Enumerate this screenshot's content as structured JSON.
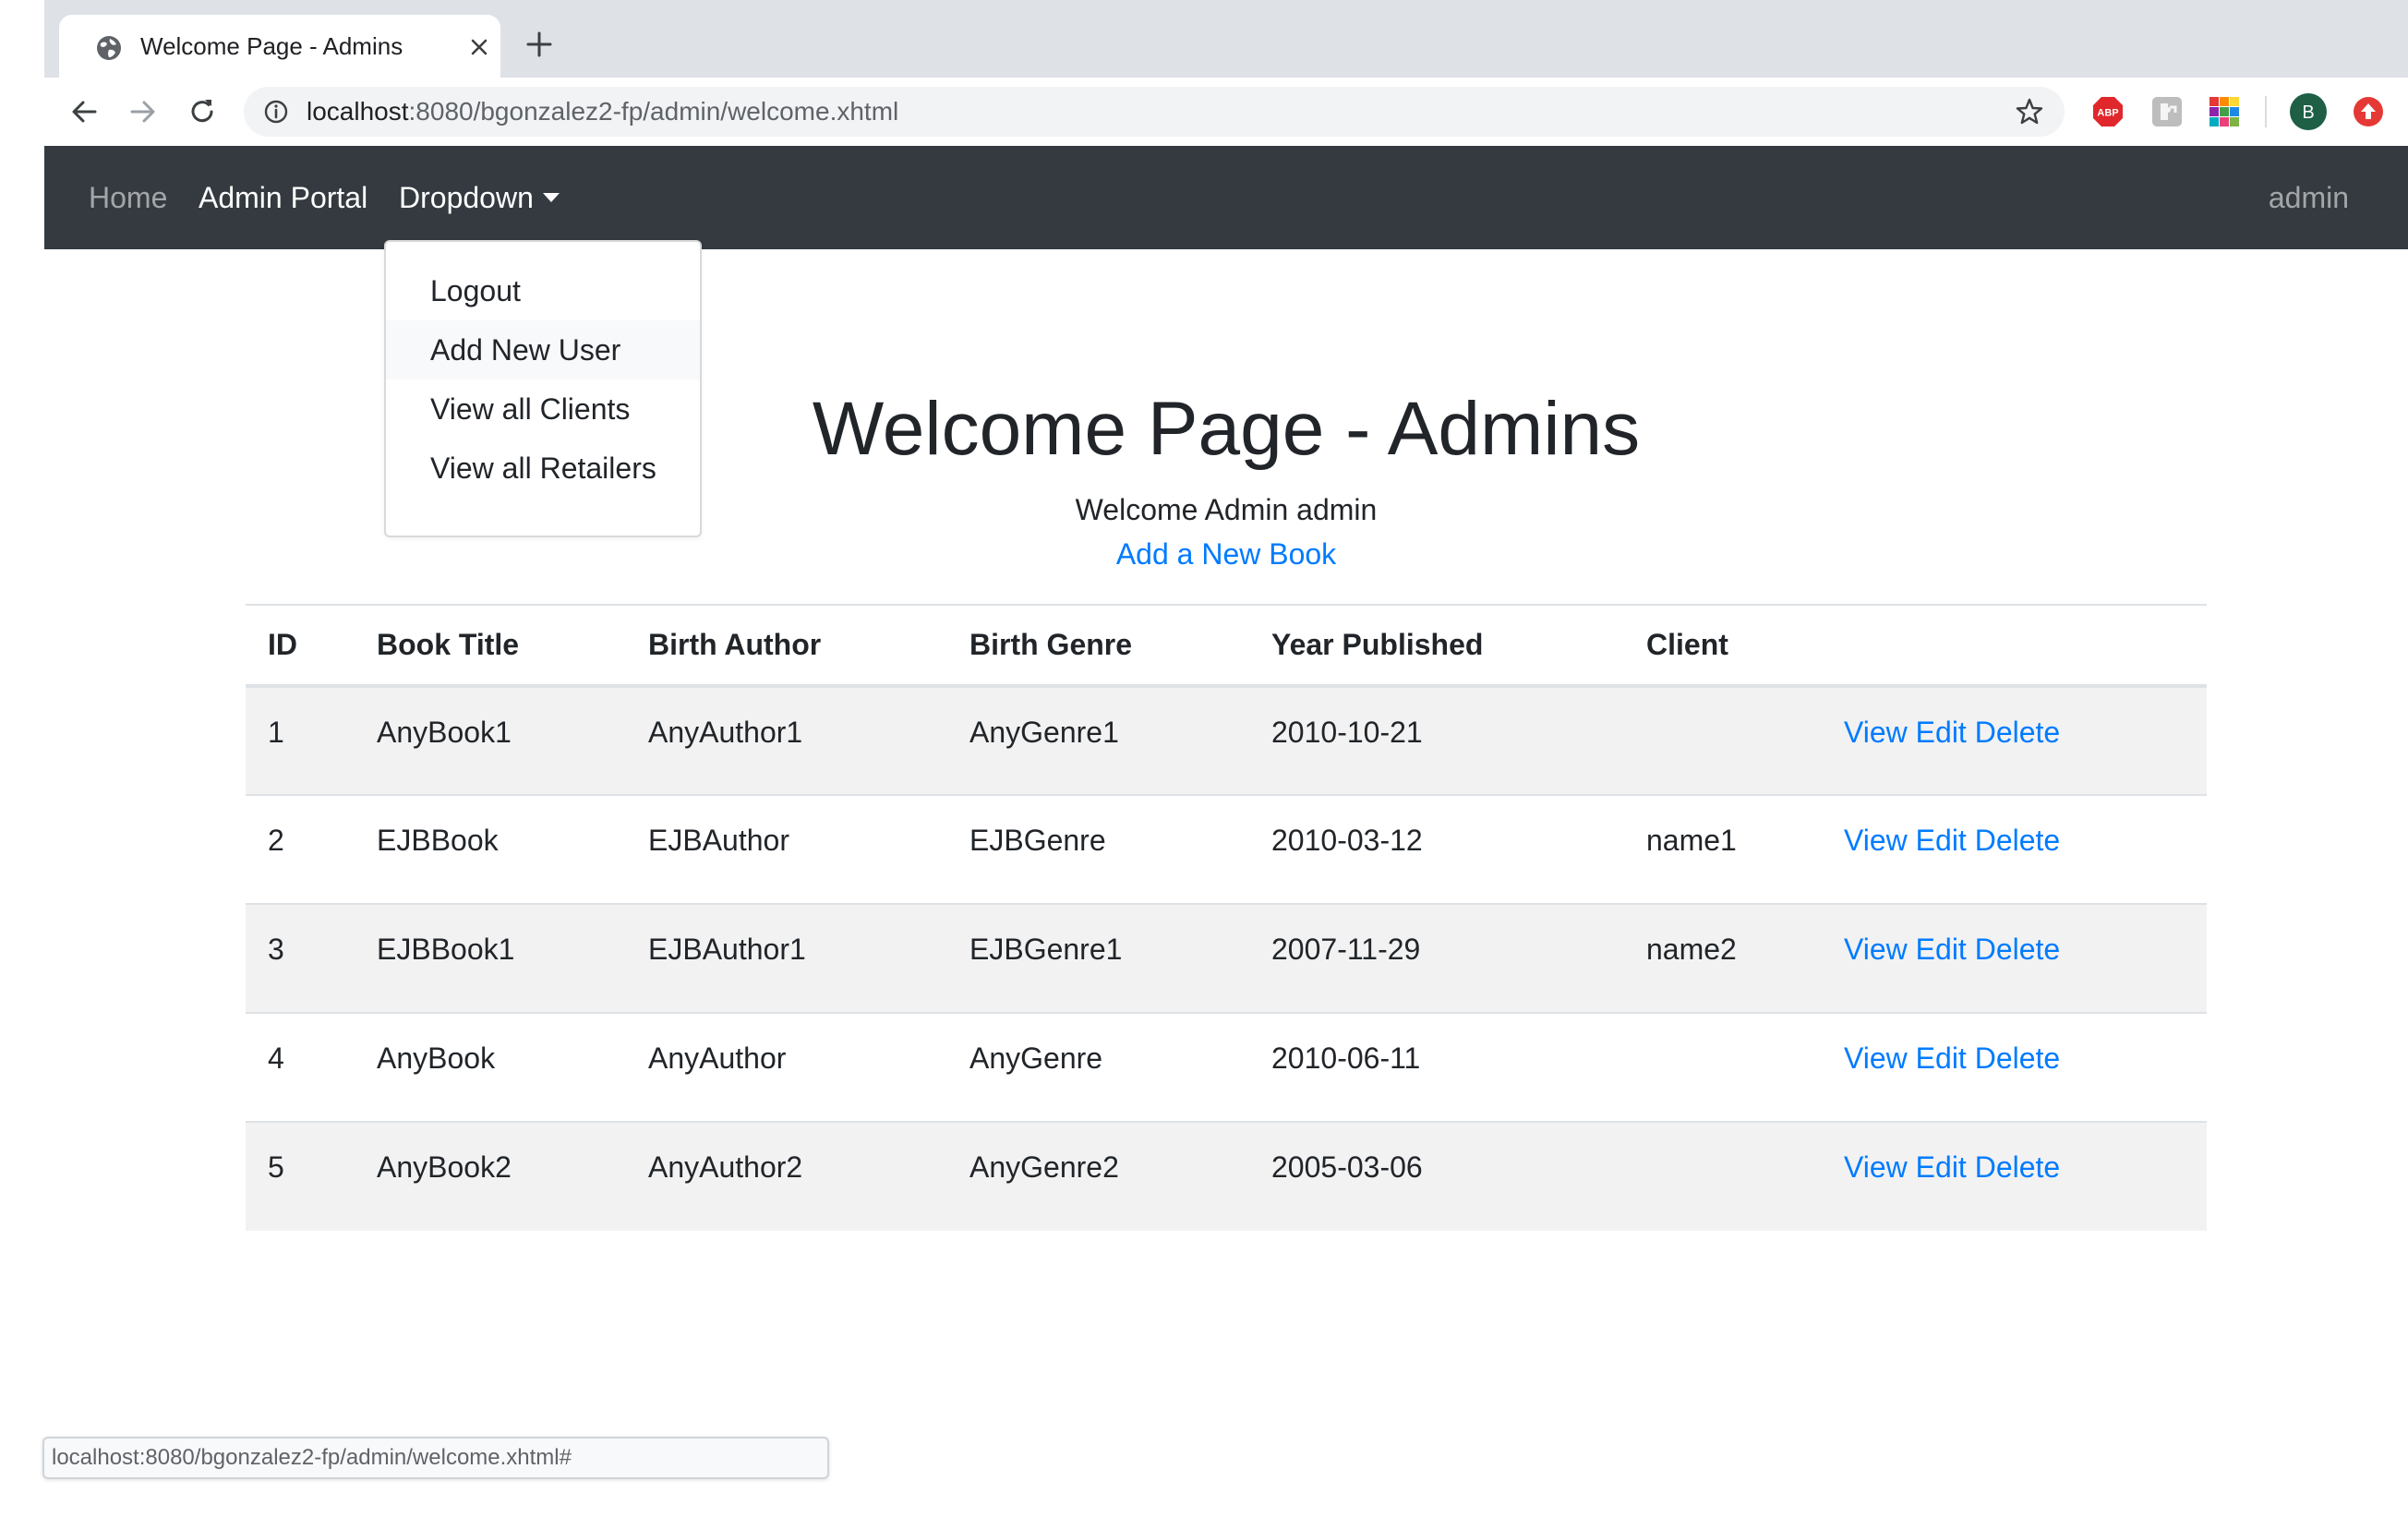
{
  "browser": {
    "tab_title": "Welcome Page - Admins",
    "url_host": "localhost",
    "url_rest": ":8080/bgonzalez2-fp/admin/welcome.xhtml",
    "profile_initial": "B",
    "status_url": "localhost:8080/bgonzalez2-fp/admin/welcome.xhtml#",
    "extensions": [
      "adblock-plus-icon",
      "extension-puzzle-icon",
      "color-grid-icon",
      "profile-avatar",
      "upload-icon"
    ]
  },
  "nav": {
    "home": "Home",
    "admin_portal": "Admin Portal",
    "dropdown": "Dropdown",
    "user": "admin"
  },
  "dropdown_menu": {
    "items": [
      "Logout",
      "Add New User",
      "View all Clients",
      "View all Retailers"
    ],
    "hovered": "Add New User"
  },
  "page": {
    "title": "Welcome Page - Admins",
    "welcome": "Welcome Admin admin",
    "add_book": "Add a New Book"
  },
  "table": {
    "headers": [
      "ID",
      "Book Title",
      "Birth Author",
      "Birth Genre",
      "Year Published",
      "Client",
      ""
    ],
    "actions": {
      "view": "View",
      "edit": "Edit",
      "delete": "Delete"
    },
    "rows": [
      {
        "id": "1",
        "title": "AnyBook1",
        "author": "AnyAuthor1",
        "genre": "AnyGenre1",
        "year": "2010-10-21",
        "client": ""
      },
      {
        "id": "2",
        "title": "EJBBook",
        "author": "EJBAuthor",
        "genre": "EJBGenre",
        "year": "2010-03-12",
        "client": "name1"
      },
      {
        "id": "3",
        "title": "EJBBook1",
        "author": "EJBAuthor1",
        "genre": "EJBGenre1",
        "year": "2007-11-29",
        "client": "name2"
      },
      {
        "id": "4",
        "title": "AnyBook",
        "author": "AnyAuthor",
        "genre": "AnyGenre",
        "year": "2010-06-11",
        "client": ""
      },
      {
        "id": "5",
        "title": "AnyBook2",
        "author": "AnyAuthor2",
        "genre": "AnyGenre2",
        "year": "2005-03-06",
        "client": ""
      }
    ]
  },
  "colors": {
    "navbar_bg": "#343a40",
    "link": "#007bff",
    "stripe": "#f2f2f2",
    "text": "#212529"
  }
}
